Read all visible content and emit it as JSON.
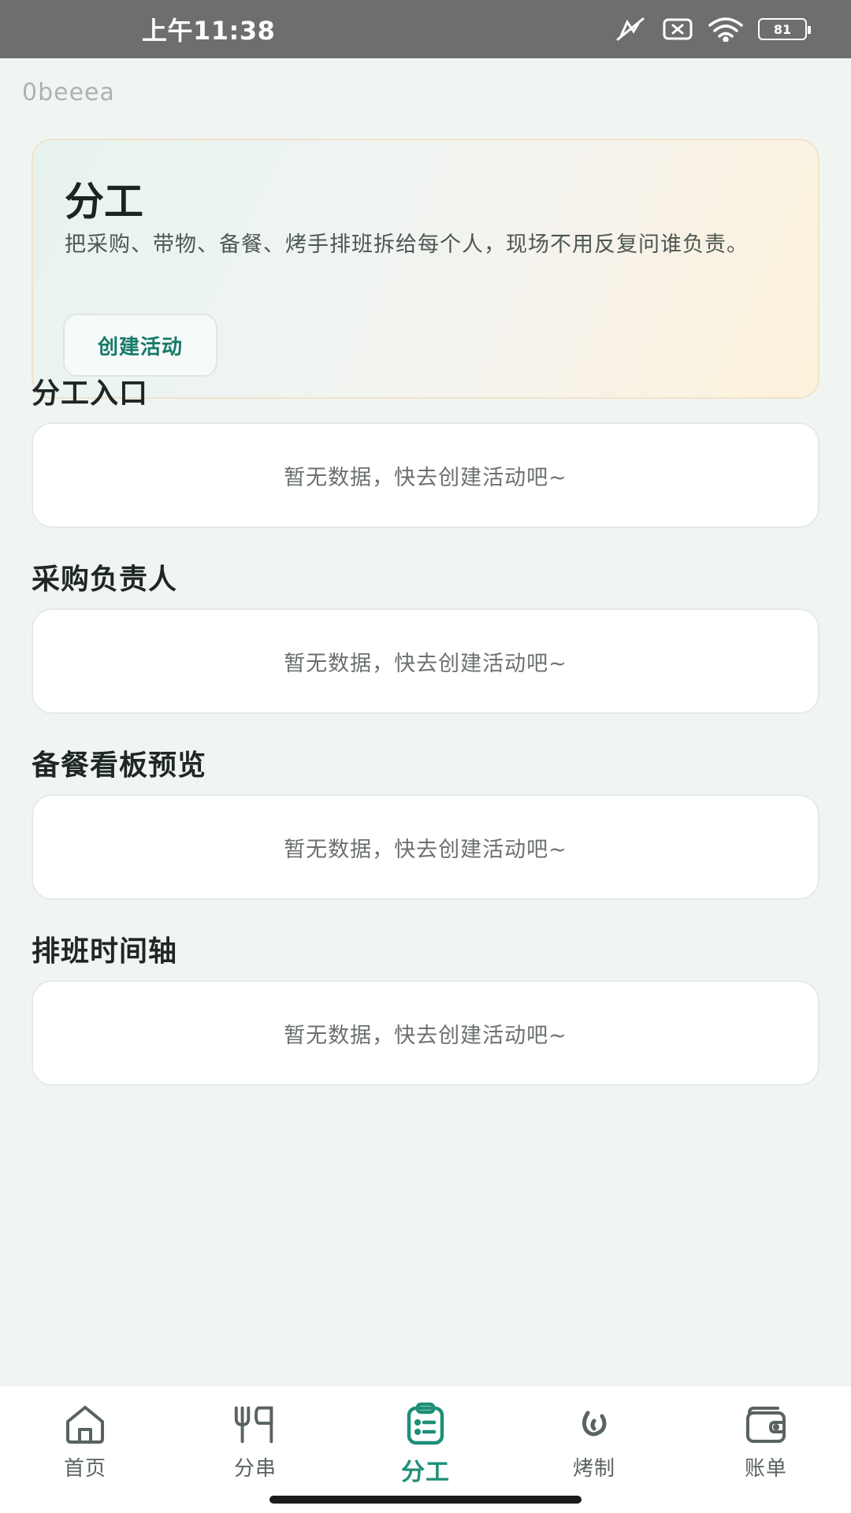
{
  "status_bar": {
    "time": "上午11:38",
    "battery": "81"
  },
  "debug_overlay": "0beeea",
  "hero": {
    "title": "分工",
    "description": "把采购、带物、备餐、烤手排班拆给每个人，现场不用反复问谁负责。",
    "button_label": "创建活动"
  },
  "sections": [
    {
      "title": "分工入口",
      "empty_text": "暂无数据，快去创建活动吧~"
    },
    {
      "title": "采购负责人",
      "empty_text": "暂无数据，快去创建活动吧~"
    },
    {
      "title": "备餐看板预览",
      "empty_text": "暂无数据，快去创建活动吧~"
    },
    {
      "title": "排班时间轴",
      "empty_text": "暂无数据，快去创建活动吧~"
    }
  ],
  "tab_bar": {
    "active": "分工",
    "items": [
      {
        "label": "首页",
        "icon": "home-icon"
      },
      {
        "label": "分串",
        "icon": "skewer-icon"
      },
      {
        "label": "分工",
        "icon": "clipboard-icon"
      },
      {
        "label": "烤制",
        "icon": "flame-icon"
      },
      {
        "label": "账单",
        "icon": "wallet-icon"
      }
    ]
  },
  "colors": {
    "accent": "#1d8f78",
    "button_text": "#177a68",
    "background": "#f1f5f2"
  }
}
